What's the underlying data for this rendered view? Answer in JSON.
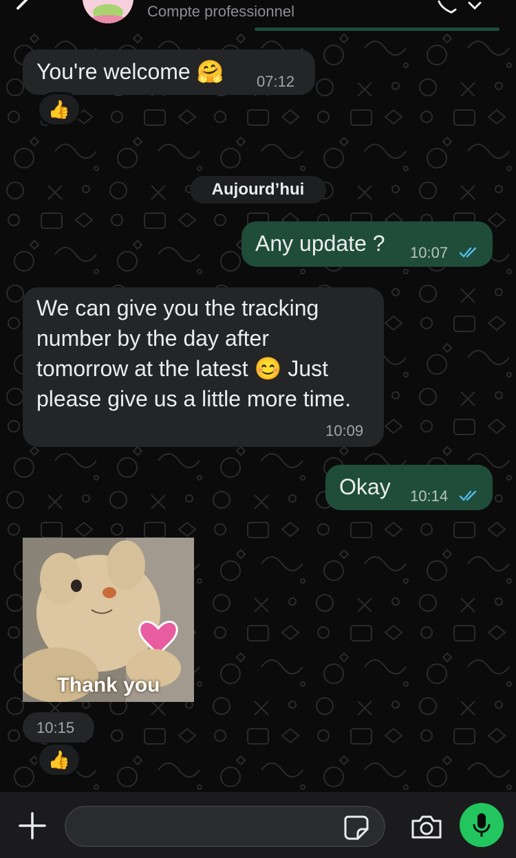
{
  "header": {
    "subtitle": "Compte professionnel"
  },
  "messages": [
    {
      "id": "m1",
      "direction": "incoming",
      "text": "You're welcome 🤗",
      "time": "07:12",
      "reaction": "👍"
    },
    {
      "id": "m2",
      "direction": "outgoing",
      "text": "Any update ?",
      "time": "10:07",
      "status": "read"
    },
    {
      "id": "m3",
      "direction": "incoming",
      "lines": [
        "We can give you the tracking",
        "number by the day after",
        "tomorrow at the latest 😊 Just",
        "please give us a little more time."
      ],
      "time": "10:09"
    },
    {
      "id": "m4",
      "direction": "outgoing",
      "text": "Okay",
      "time": "10:14",
      "status": "read"
    },
    {
      "id": "m5",
      "direction": "incoming",
      "type": "sticker",
      "caption": "Thank you",
      "time": "10:15",
      "reaction": "👍"
    }
  ],
  "date_separator": "Aujourd’hui",
  "composer": {
    "placeholder": "",
    "icons": [
      "plus-icon",
      "sticker-icon",
      "camera-icon",
      "mic-icon"
    ]
  },
  "colors": {
    "background": "#0b0b0c",
    "incoming_bubble": "#232526",
    "outgoing_bubble": "#1f4d3a",
    "read_ticks": "#53bdeb",
    "mic_button": "#22c55e"
  }
}
